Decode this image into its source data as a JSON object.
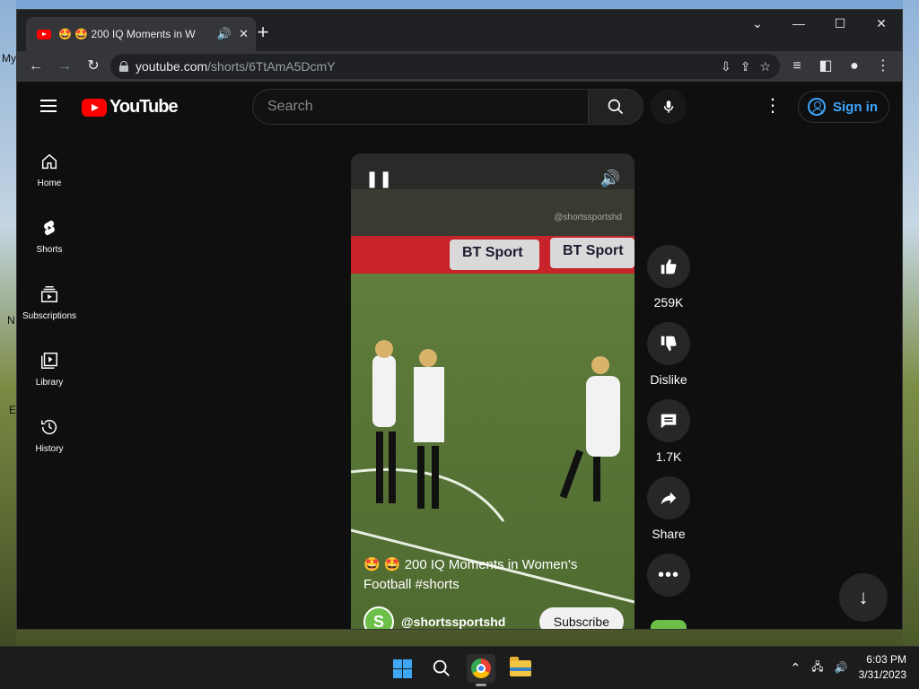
{
  "desktop": {
    "left_text_1": "My",
    "left_text_2": "N",
    "left_text_3": "E"
  },
  "browser": {
    "tab_title": "🤩 🤩 200 IQ Moments in W",
    "new_tab_label": "+",
    "url_host": "youtube.com",
    "url_path": "/shorts/6TtAmA5DcmY"
  },
  "youtube": {
    "logo_text": "YouTube",
    "search_placeholder": "Search",
    "sign_in_label": "Sign in",
    "guide": [
      {
        "label": "Home",
        "icon": "home-icon"
      },
      {
        "label": "Shorts",
        "icon": "shorts-icon"
      },
      {
        "label": "Subscriptions",
        "icon": "subscriptions-icon"
      },
      {
        "label": "Library",
        "icon": "library-icon"
      },
      {
        "label": "History",
        "icon": "history-icon"
      }
    ],
    "short": {
      "watermark": "@shortssportshd",
      "title": "🤩 🤩 200 IQ Moments in Women's Football #shorts",
      "channel": "@shortssportshd",
      "subscribe_label": "Subscribe",
      "ad_board_1": "BT Sport",
      "ad_board_2": "BT Sport"
    },
    "actions": {
      "likes": "259K",
      "dislike_label": "Dislike",
      "comments": "1.7K",
      "share_label": "Share"
    }
  },
  "taskbar": {
    "time": "6:03 PM",
    "date": "3/31/2023"
  },
  "colors": {
    "accent": "#3ea6ff",
    "brand_red": "#ff0000",
    "background": "#0f0f0f"
  }
}
